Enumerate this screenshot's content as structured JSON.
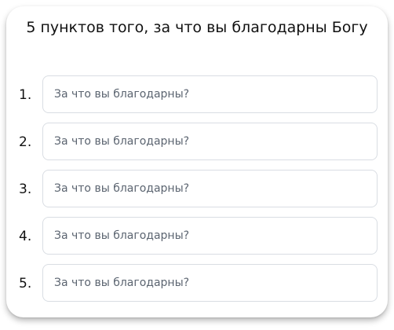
{
  "title": "5 пунктов того, за что вы благодарны Богу",
  "items": [
    {
      "number": "1.",
      "placeholder": "За что вы благодарны?",
      "value": ""
    },
    {
      "number": "2.",
      "placeholder": "За что вы благодарны?",
      "value": ""
    },
    {
      "number": "3.",
      "placeholder": "За что вы благодарны?",
      "value": ""
    },
    {
      "number": "4.",
      "placeholder": "За что вы благодарны?",
      "value": ""
    },
    {
      "number": "5.",
      "placeholder": "За что вы благодарны?",
      "value": ""
    }
  ]
}
